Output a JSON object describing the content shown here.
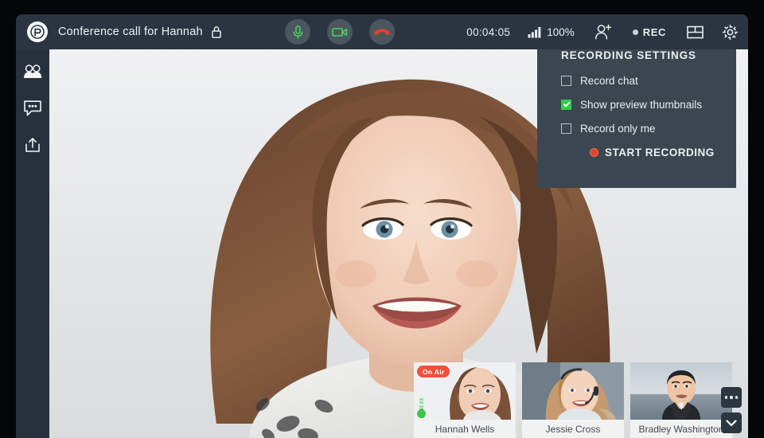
{
  "window": {
    "title": "Conference call for Hannah",
    "lock_icon": "lock-icon",
    "logo_icon": "app-logo-icon"
  },
  "toolbar": {
    "mic_icon": "microphone-icon",
    "camera_icon": "video-camera-icon",
    "hangup_icon": "hangup-phone-icon",
    "timer": "00:04:05",
    "signal_icon": "signal-bars-icon",
    "signal_percent": "100%",
    "add_user_icon": "add-user-icon",
    "rec_label": "REC",
    "rec_dot_icon": "record-dot-icon",
    "layout_icon": "layout-grid-icon",
    "settings_icon": "gear-icon"
  },
  "sidebar": {
    "items": [
      {
        "name": "participants",
        "icon": "people-icon"
      },
      {
        "name": "chat",
        "icon": "chat-bubble-icon"
      },
      {
        "name": "share",
        "icon": "share-upload-icon"
      }
    ]
  },
  "recording_panel": {
    "title": "RECORDING SETTINGS",
    "options": [
      {
        "label": "Record chat",
        "checked": false
      },
      {
        "label": "Show  preview thumbnails",
        "checked": true
      },
      {
        "label": "Record only me",
        "checked": false
      }
    ],
    "start_button": "START RECORDING"
  },
  "participants": [
    {
      "name": "Hannah Wells",
      "on_air": true,
      "badge": "On Air",
      "speaking": true
    },
    {
      "name": "Jessie Cross",
      "on_air": false,
      "badge": "",
      "speaking": false
    },
    {
      "name": "Bradley Washington",
      "on_air": false,
      "badge": "",
      "speaking": false
    }
  ],
  "corner_controls": {
    "more_icon": "more-options-icon",
    "collapse_icon": "chevron-down-icon"
  },
  "colors": {
    "chrome": "#2a3541",
    "sidebar": "#26313c",
    "panel": "#3b4650",
    "accent_green": "#2ecc47",
    "accent_red": "#f0503a",
    "hangup_red": "#e8412b"
  }
}
